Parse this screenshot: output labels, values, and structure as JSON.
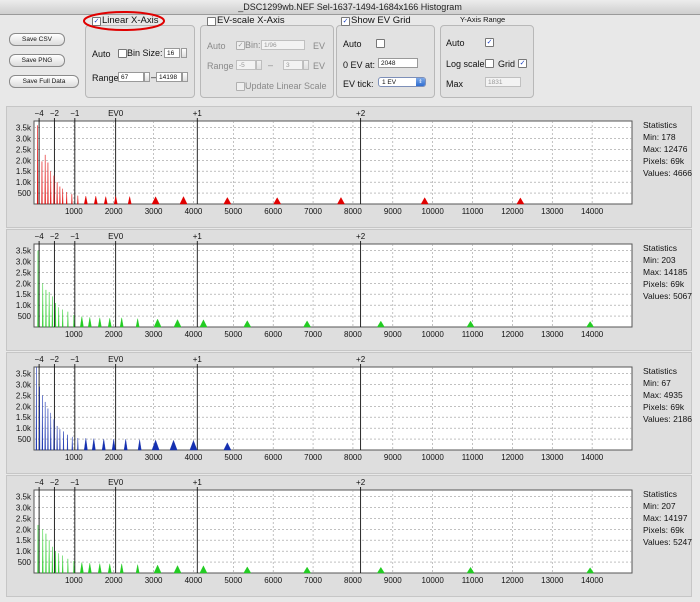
{
  "window": {
    "title": "_DSC1299wb.NEF Sel-1637-1494-1684x166 Histogram"
  },
  "buttons": {
    "save_csv": "Save CSV",
    "save_png": "Save PNG",
    "save_full": "Save Full Data"
  },
  "linear": {
    "checkbox_label": "Linear X-Axis",
    "checked": true,
    "auto_label": "Auto",
    "bin_label": "Bin Size:",
    "bin_value": "16",
    "range_label": "Range:",
    "range_min": "67",
    "range_sep": "–",
    "range_max": "14198"
  },
  "ev": {
    "checkbox_label": "EV-scale X-Axis",
    "auto_label": "Auto",
    "bin_label": "Bin:",
    "bin_value": "1/96",
    "ev_unit1": "EV",
    "range_label": "Range",
    "range_min": "-5",
    "range_sep": "–",
    "range_max": "3",
    "ev_unit2": "EV",
    "update_label": "Update Linear Scale"
  },
  "grid": {
    "checkbox_label": "Show EV Grid",
    "checked": true,
    "auto_label": "Auto",
    "zero_label": "0 EV at:",
    "zero_value": "2048",
    "tick_label": "EV tick:",
    "tick_value": "1 EV"
  },
  "yaxis": {
    "group_label": "Y-Axis Range",
    "auto_label": "Auto",
    "log_label": "Log scale",
    "grid_label": "Grid",
    "max_label": "Max",
    "max_value": "1831"
  },
  "icons": {
    "check": "✓",
    "spin_up": "▲",
    "spin_down": "▼",
    "select_arrows": "⇕"
  },
  "ev_labels": [
    "−4",
    "−2",
    "−1",
    "EV0",
    "+1",
    "+2"
  ],
  "ev_values": [
    128,
    512,
    1024,
    2048,
    4096,
    8192
  ],
  "y_labels": [
    "3.5k",
    "3.0k",
    "2.5k",
    "2.0k",
    "1.5k",
    "1.0k",
    "500"
  ],
  "x_labels": [
    "1000",
    "2000",
    "3000",
    "4000",
    "5000",
    "6000",
    "7000",
    "8000",
    "9000",
    "10000",
    "11000",
    "12000",
    "13000",
    "14000"
  ],
  "stats_labels": {
    "heading": "Statistics",
    "min": "Min: ",
    "max": "Max: ",
    "pixels": "Pixels: ",
    "values": "Values: "
  },
  "chart_data": [
    {
      "type": "area",
      "series": [
        {
          "color": "#e00000"
        }
      ],
      "xlim": [
        0,
        15000
      ],
      "ylim": [
        0,
        3800
      ],
      "peaks": [
        [
          90,
          3600
        ],
        [
          200,
          1950
        ],
        [
          280,
          2250
        ],
        [
          350,
          1900
        ],
        [
          420,
          1500
        ],
        [
          500,
          1300
        ],
        [
          580,
          1000
        ],
        [
          650,
          800
        ],
        [
          720,
          700
        ],
        [
          820,
          550
        ],
        [
          950,
          450
        ],
        [
          1100,
          380
        ],
        [
          1300,
          360
        ],
        [
          1550,
          360
        ],
        [
          1800,
          340
        ],
        [
          2050,
          350
        ],
        [
          2400,
          340
        ],
        [
          3050,
          330
        ],
        [
          3750,
          340
        ],
        [
          4850,
          300
        ],
        [
          6100,
          290
        ],
        [
          7700,
          300
        ],
        [
          9800,
          290
        ],
        [
          12200,
          280
        ]
      ],
      "stats": {
        "min": "178",
        "max": "12476",
        "pixels": "69k",
        "values": "4666"
      }
    },
    {
      "type": "area",
      "series": [
        {
          "color": "#22cc22"
        }
      ],
      "xlim": [
        0,
        15000
      ],
      "ylim": [
        0,
        3800
      ],
      "peaks": [
        [
          100,
          3500
        ],
        [
          220,
          2000
        ],
        [
          300,
          1700
        ],
        [
          380,
          1600
        ],
        [
          460,
          1400
        ],
        [
          540,
          1100
        ],
        [
          620,
          900
        ],
        [
          720,
          800
        ],
        [
          850,
          700
        ],
        [
          1000,
          550
        ],
        [
          1200,
          480
        ],
        [
          1400,
          440
        ],
        [
          1650,
          420
        ],
        [
          1900,
          400
        ],
        [
          2200,
          420
        ],
        [
          2600,
          380
        ],
        [
          3100,
          360
        ],
        [
          3600,
          340
        ],
        [
          4250,
          330
        ],
        [
          5350,
          290
        ],
        [
          6850,
          280
        ],
        [
          8700,
          270
        ],
        [
          10950,
          270
        ],
        [
          13950,
          250
        ]
      ],
      "stats": {
        "min": "203",
        "max": "14185",
        "pixels": "69k",
        "values": "5067"
      }
    },
    {
      "type": "area",
      "series": [
        {
          "color": "#1530b0"
        }
      ],
      "xlim": [
        0,
        15000
      ],
      "ylim": [
        0,
        3800
      ],
      "peaks": [
        [
          60,
          3800
        ],
        [
          140,
          2900
        ],
        [
          210,
          2500
        ],
        [
          280,
          2200
        ],
        [
          350,
          1900
        ],
        [
          420,
          1700
        ],
        [
          500,
          1400
        ],
        [
          580,
          1100
        ],
        [
          650,
          950
        ],
        [
          740,
          850
        ],
        [
          840,
          700
        ],
        [
          960,
          600
        ],
        [
          1100,
          550
        ],
        [
          1300,
          540
        ],
        [
          1500,
          520
        ],
        [
          1750,
          500
        ],
        [
          2000,
          500
        ],
        [
          2300,
          490
        ],
        [
          2650,
          470
        ],
        [
          3050,
          450
        ],
        [
          3500,
          440
        ],
        [
          4000,
          430
        ],
        [
          4850,
          330
        ]
      ],
      "stats": {
        "min": "67",
        "max": "4935",
        "pixels": "69k",
        "values": "2186"
      }
    },
    {
      "type": "area",
      "series": [
        {
          "color": "#22cc22"
        }
      ],
      "xlim": [
        0,
        15000
      ],
      "ylim": [
        0,
        3800
      ],
      "peaks": [
        [
          100,
          2200
        ],
        [
          220,
          2000
        ],
        [
          300,
          1800
        ],
        [
          380,
          1500
        ],
        [
          460,
          1200
        ],
        [
          540,
          1000
        ],
        [
          620,
          900
        ],
        [
          720,
          800
        ],
        [
          850,
          650
        ],
        [
          1000,
          550
        ],
        [
          1200,
          480
        ],
        [
          1400,
          450
        ],
        [
          1650,
          430
        ],
        [
          1900,
          420
        ],
        [
          2200,
          420
        ],
        [
          2600,
          380
        ],
        [
          3100,
          360
        ],
        [
          3600,
          340
        ],
        [
          4250,
          330
        ],
        [
          5350,
          280
        ],
        [
          6850,
          270
        ],
        [
          8700,
          260
        ],
        [
          10950,
          260
        ],
        [
          13950,
          240
        ]
      ],
      "stats": {
        "min": "207",
        "max": "14197",
        "pixels": "69k",
        "values": "5247"
      }
    }
  ]
}
